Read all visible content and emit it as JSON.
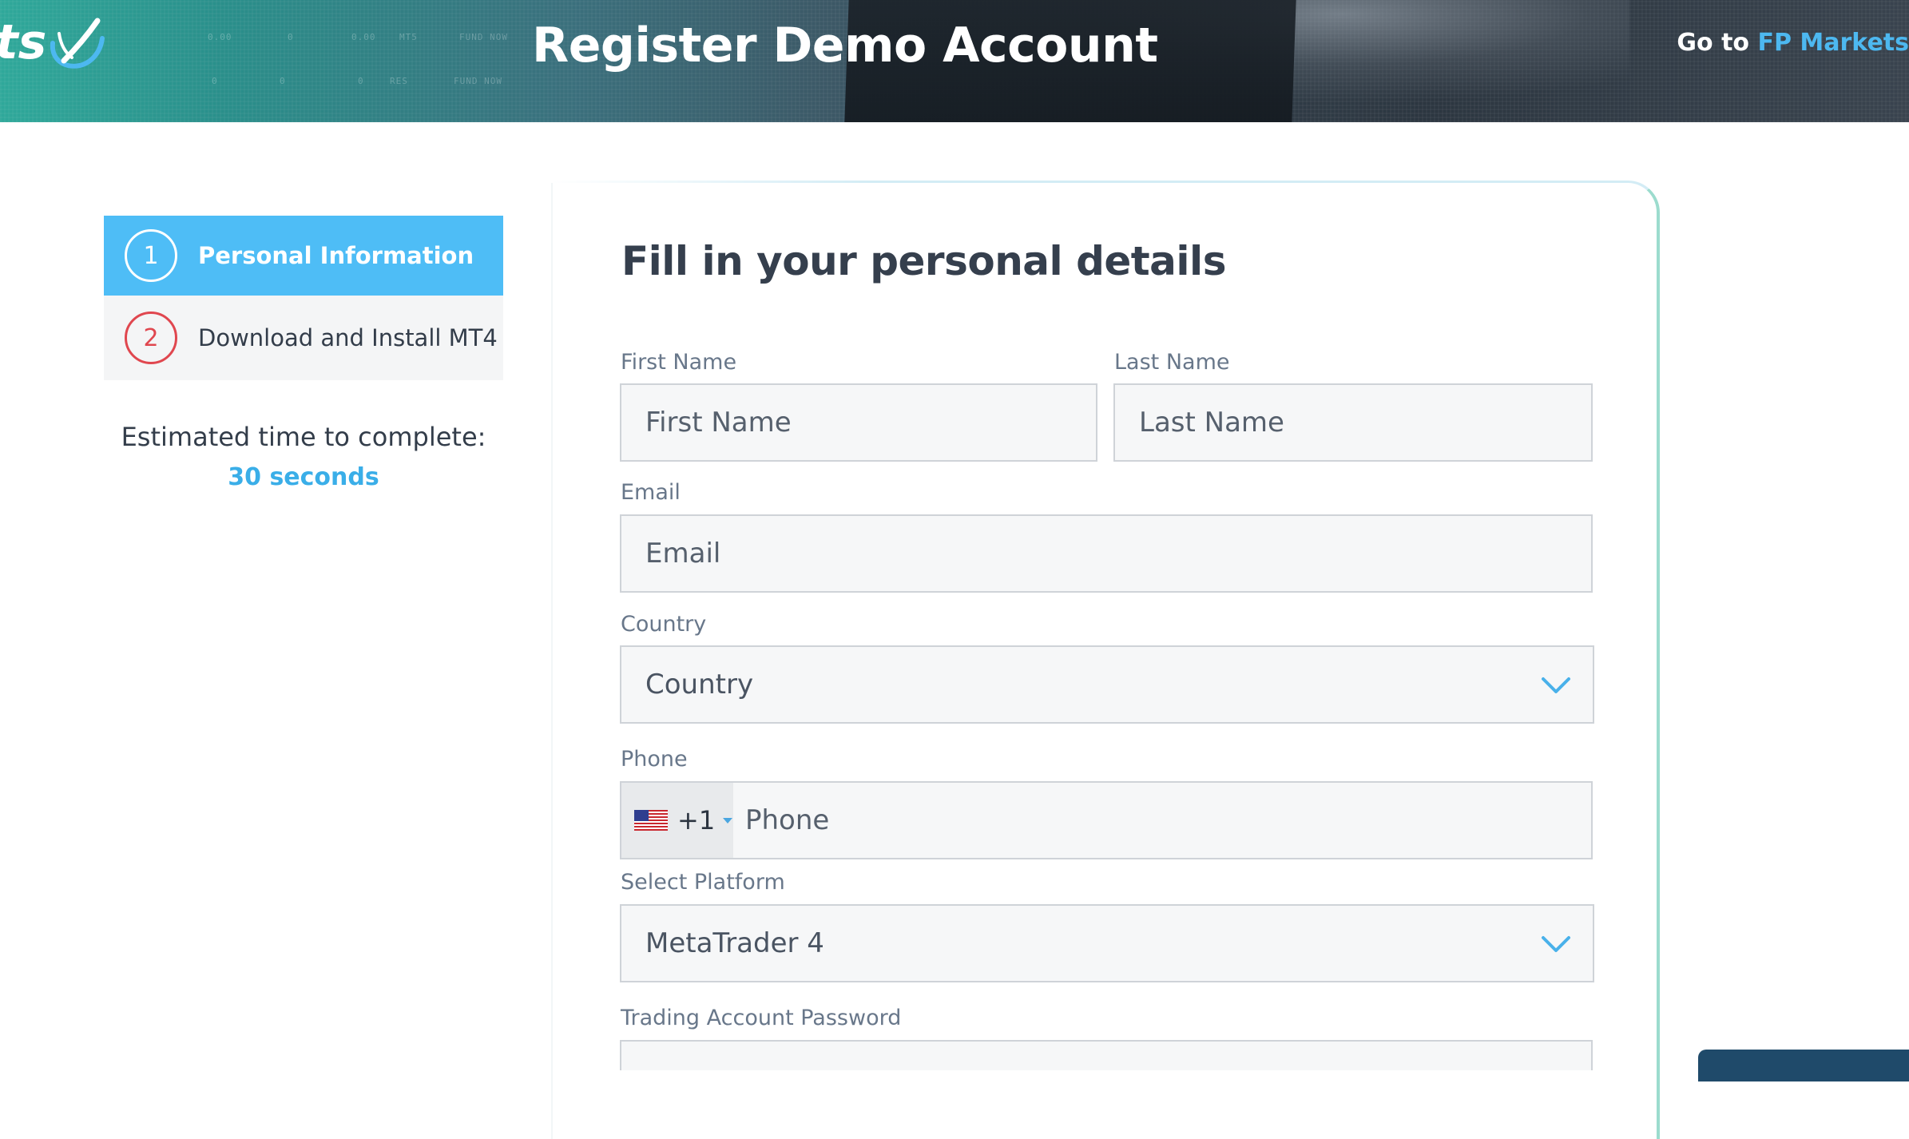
{
  "header": {
    "logo_text": "ts",
    "title": "Register Demo Account",
    "goto_prefix": "Go to",
    "goto_link": "FP Markets",
    "background_texture_text": [
      "0.00",
      "0",
      "0.00",
      "MT5",
      "FUND NOW",
      "0",
      "0",
      "0",
      "RES",
      "FUND NOW"
    ]
  },
  "stepper": {
    "steps": [
      {
        "number": "1",
        "label": "Personal Information",
        "state": "active"
      },
      {
        "number": "2",
        "label": "Download and Install MT4",
        "state": "inactive"
      }
    ],
    "estimate_label": "Estimated time to complete:",
    "estimate_value": "30 seconds"
  },
  "form": {
    "title": "Fill in your personal details",
    "first_name": {
      "label": "First Name",
      "placeholder": "First Name"
    },
    "last_name": {
      "label": "Last Name",
      "placeholder": "Last Name"
    },
    "email": {
      "label": "Email",
      "placeholder": "Email"
    },
    "country": {
      "label": "Country",
      "value": "Country"
    },
    "phone": {
      "label": "Phone",
      "country_code": "+1",
      "placeholder": "Phone",
      "flag": "us-flag-icon"
    },
    "platform": {
      "label": "Select Platform",
      "value": "MetaTrader 4"
    },
    "password": {
      "label": "Trading Account Password"
    }
  },
  "colors": {
    "accent": "#4ebdf6",
    "step_inactive": "#e0474f",
    "link": "#4db8f0",
    "estimate": "#3aaee8"
  }
}
